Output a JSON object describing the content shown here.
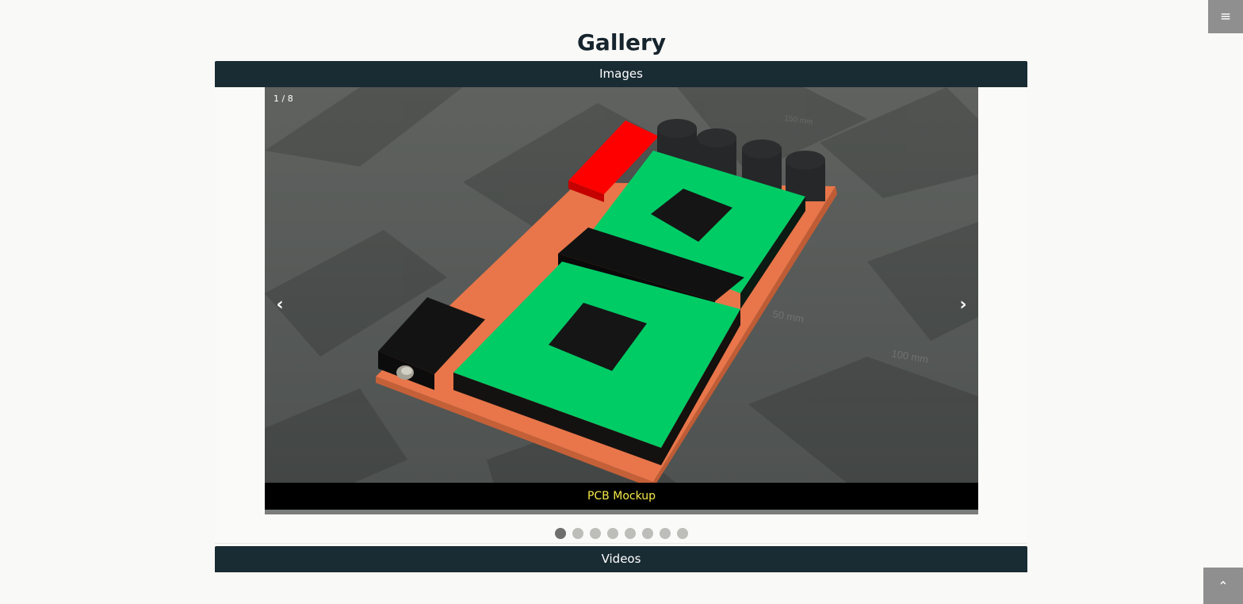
{
  "page": {
    "title": "Gallery"
  },
  "menu": {
    "icon": "menu-icon",
    "glyph": "≡"
  },
  "sections": {
    "images_label": "Images",
    "videos_label": "Videos"
  },
  "slider": {
    "counter": "1 / 8",
    "caption": "PCB Mockup",
    "prev_glyph": "‹",
    "next_glyph": "›",
    "current": 1,
    "total": 8,
    "image_labels": [
      "50 mm",
      "100 mm",
      "150 mm"
    ]
  },
  "scroll_top": {
    "icon": "chevron-up-icon",
    "glyph": "⌃"
  },
  "colors": {
    "header": "#192b33",
    "caption": "#f6e94a",
    "pcb_orange": "#e8764a",
    "pcb_green": "#00cc66",
    "pcb_red": "#ff0000"
  }
}
